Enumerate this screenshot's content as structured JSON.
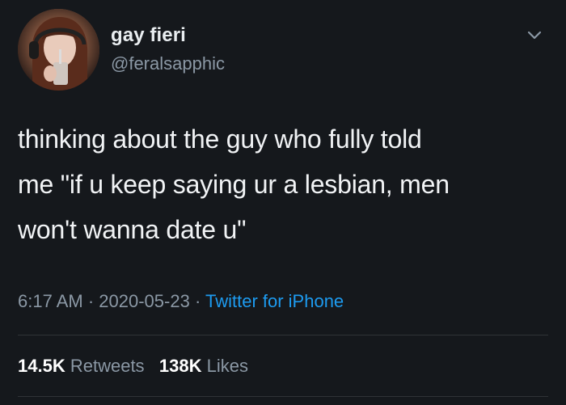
{
  "user": {
    "display_name": "gay fieri",
    "handle": "@feralsapphic"
  },
  "tweet": {
    "lines": [
      "thinking about the guy who fully told",
      "me \"if u keep saying ur a lesbian, men",
      "won't wanna date u\""
    ]
  },
  "meta": {
    "time": "6:17 AM",
    "sep1": " · ",
    "date": "2020-05-23",
    "sep2": " · ",
    "source": "Twitter for iPhone"
  },
  "stats": {
    "retweets_count": "14.5K",
    "retweets_label": "Retweets",
    "likes_count": "138K",
    "likes_label": "Likes"
  },
  "icons": {
    "menu": "chevron-down-icon",
    "avatar": "avatar"
  },
  "colors": {
    "background": "#15181c",
    "primary_text": "#f1f3f5",
    "secondary_text": "#8b98a5",
    "link": "#1d9bf0"
  }
}
